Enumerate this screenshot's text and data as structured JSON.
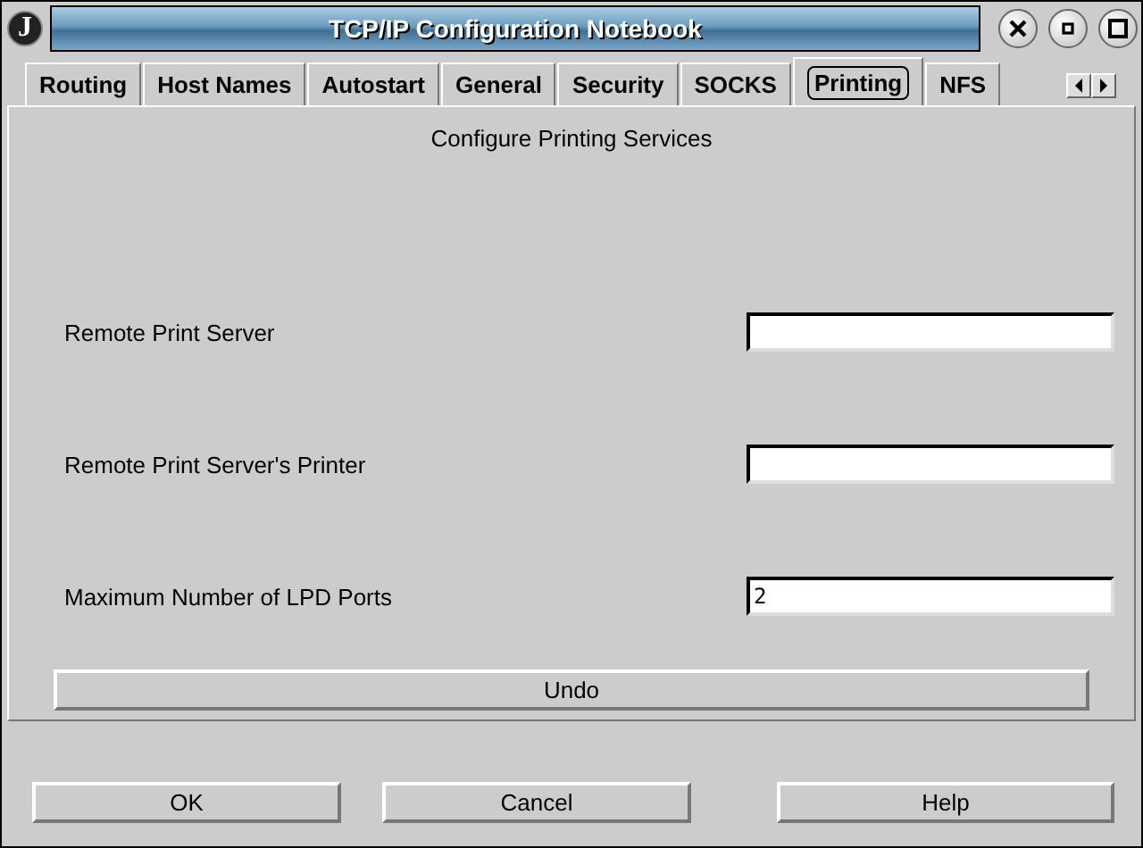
{
  "window": {
    "title": "TCP/IP Configuration Notebook",
    "logo": "J"
  },
  "tabs": [
    {
      "label": "Routing",
      "selected": false
    },
    {
      "label": "Host Names",
      "selected": false
    },
    {
      "label": "Autostart",
      "selected": false
    },
    {
      "label": "General",
      "selected": false
    },
    {
      "label": "Security",
      "selected": false
    },
    {
      "label": "SOCKS",
      "selected": false
    },
    {
      "label": "Printing",
      "selected": true
    },
    {
      "label": "NFS",
      "selected": false
    }
  ],
  "page": {
    "heading": "Configure Printing Services",
    "fields": [
      {
        "label": "Remote Print Server"
      },
      {
        "label": "Remote Print Server's Printer"
      },
      {
        "label": "Maximum Number of LPD Ports",
        "value": "2"
      }
    ],
    "undo_button": "Undo"
  },
  "buttons": [
    "OK",
    "Cancel",
    "Help"
  ]
}
